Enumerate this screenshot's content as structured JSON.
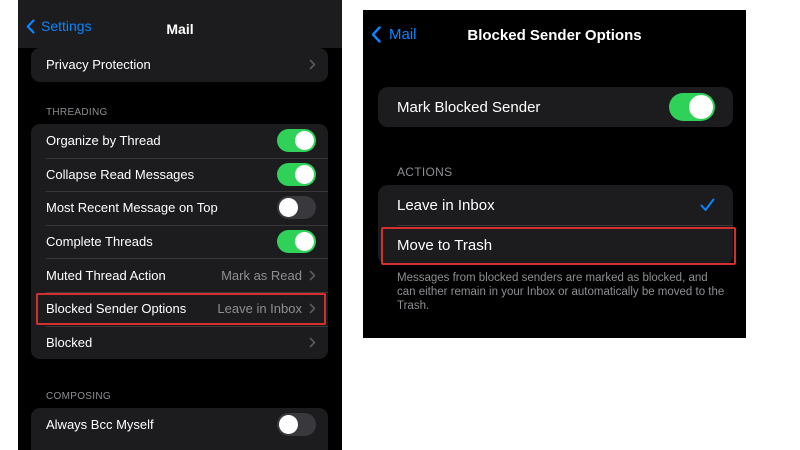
{
  "left": {
    "nav": {
      "back_label": "Settings",
      "title": "Mail"
    },
    "top_row": {
      "label": "Privacy Protection"
    },
    "threading": {
      "header": "THREADING",
      "rows": [
        {
          "label": "Organize by Thread",
          "toggle": "on"
        },
        {
          "label": "Collapse Read Messages",
          "toggle": "on"
        },
        {
          "label": "Most Recent Message on Top",
          "toggle": "off"
        },
        {
          "label": "Complete Threads",
          "toggle": "on"
        },
        {
          "label": "Muted Thread Action",
          "value": "Mark as Read"
        },
        {
          "label": "Blocked Sender Options",
          "value": "Leave in Inbox"
        },
        {
          "label": "Blocked"
        }
      ]
    },
    "composing": {
      "header": "COMPOSING",
      "rows": [
        {
          "label": "Always Bcc Myself",
          "toggle": "off"
        }
      ]
    }
  },
  "right": {
    "nav": {
      "back_label": "Mail",
      "title": "Blocked Sender Options"
    },
    "mark_blocked": {
      "label": "Mark Blocked Sender",
      "toggle": "on"
    },
    "actions": {
      "header": "ACTIONS",
      "options": [
        {
          "label": "Leave in Inbox",
          "selected": true
        },
        {
          "label": "Move to Trash",
          "selected": false
        }
      ]
    },
    "footer": "Messages from blocked senders are marked as blocked, and can either remain in your Inbox or automatically be moved to the Trash."
  },
  "colors": {
    "accent": "#0a84ff",
    "toggle_on": "#30d158",
    "highlight": "#d32f2f"
  }
}
